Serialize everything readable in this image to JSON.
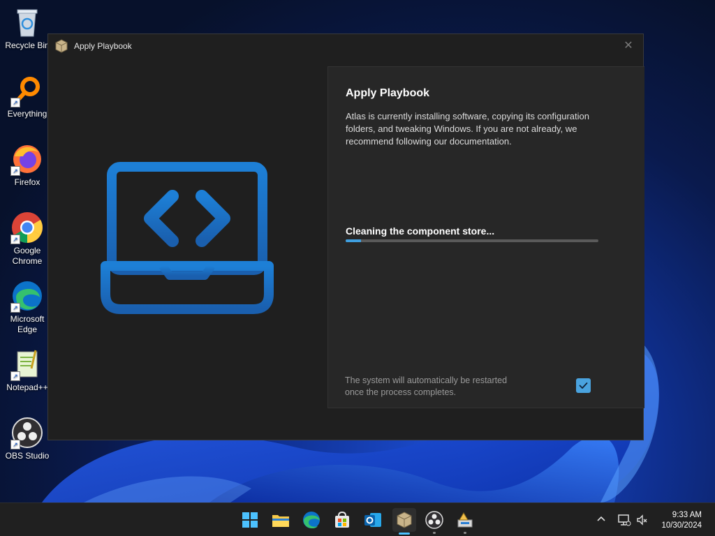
{
  "desktop": {
    "icons": [
      {
        "label": "Recycle Bin",
        "icon": "recycle-bin-icon"
      },
      {
        "label": "Everything",
        "icon": "everything-icon"
      },
      {
        "label": "Firefox",
        "icon": "firefox-icon"
      },
      {
        "label": "Google Chrome",
        "icon": "chrome-icon"
      },
      {
        "label": "Microsoft Edge",
        "icon": "edge-icon"
      },
      {
        "label": "Notepad++",
        "icon": "notepadpp-icon"
      },
      {
        "label": "OBS Studio",
        "icon": "obs-icon"
      }
    ]
  },
  "window": {
    "title": "Apply Playbook",
    "close_symbol": "✕",
    "panel": {
      "heading": "Apply Playbook",
      "description": "Atlas is currently installing software, copying its configuration folders, and tweaking Windows. If you are not already, we recommend following our documentation.",
      "status": "Cleaning the component store...",
      "progress": 0.06,
      "restart_note": "The system will automatically be restarted once the process completes.",
      "restart_checked": true
    }
  },
  "taskbar": {
    "apps": [
      {
        "name": "start-button",
        "icon": "windows-icon"
      },
      {
        "name": "file-explorer",
        "icon": "folder-icon"
      },
      {
        "name": "edge",
        "icon": "edge-icon"
      },
      {
        "name": "microsoft-store",
        "icon": "store-icon"
      },
      {
        "name": "outlook",
        "icon": "outlook-icon"
      },
      {
        "name": "atlas-playbook",
        "icon": "package-icon",
        "active": true
      },
      {
        "name": "obs",
        "icon": "obs-icon"
      },
      {
        "name": "ame-wizard",
        "icon": "wizard-icon"
      }
    ],
    "tray": {
      "time": "9:33 AM",
      "date": "10/30/2024"
    }
  },
  "colors": {
    "accent": "#4aa3df",
    "window_bg": "#1f1f1f",
    "panel_bg": "#272727",
    "illustration_blue": "#1f74c4"
  }
}
